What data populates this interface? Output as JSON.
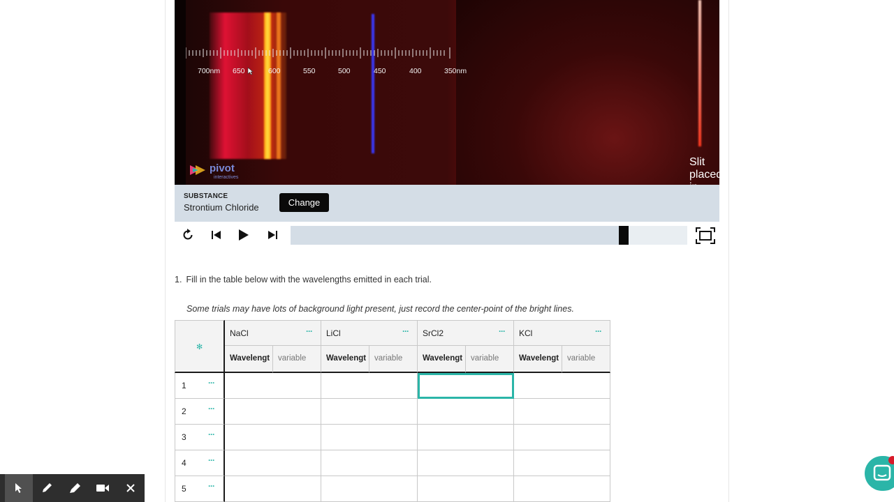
{
  "video": {
    "caption": "Slit placed in front of flame",
    "logo_word": "pivot",
    "logo_sub": "interactives",
    "scale_labels": [
      "700nm",
      "650",
      "600",
      "550",
      "500",
      "450",
      "400",
      "350nm"
    ]
  },
  "substance": {
    "label": "SUBSTANCE",
    "value": "Strontium Chloride",
    "change_button": "Change"
  },
  "playback": {
    "progress": 0.84,
    "icons": [
      "replay-icon",
      "skip-back-icon",
      "play-icon",
      "skip-forward-icon",
      "fullscreen-icon"
    ]
  },
  "question": {
    "number": "1.",
    "text": "Fill in the table below with the wavelengths emitted in each trial.",
    "note": "Some trials may have lots of background light present, just record the center-point of the bright lines."
  },
  "table": {
    "columns": [
      {
        "name": "NaCl",
        "sub1": "Wavelengt",
        "sub2": "variable"
      },
      {
        "name": "LiCl",
        "sub1": "Wavelengt",
        "sub2": "variable"
      },
      {
        "name": "SrCl2",
        "sub1": "Wavelengt",
        "sub2": "variable"
      },
      {
        "name": "KCl",
        "sub1": "Wavelengt",
        "sub2": "variable"
      }
    ],
    "rows": [
      "1",
      "2",
      "3",
      "4",
      "5"
    ],
    "menu_glyph": "···"
  },
  "colors": {
    "accent": "#2bb5a8",
    "substance_bar": "#d4dde6",
    "toolbar": "#2e2e2e"
  }
}
